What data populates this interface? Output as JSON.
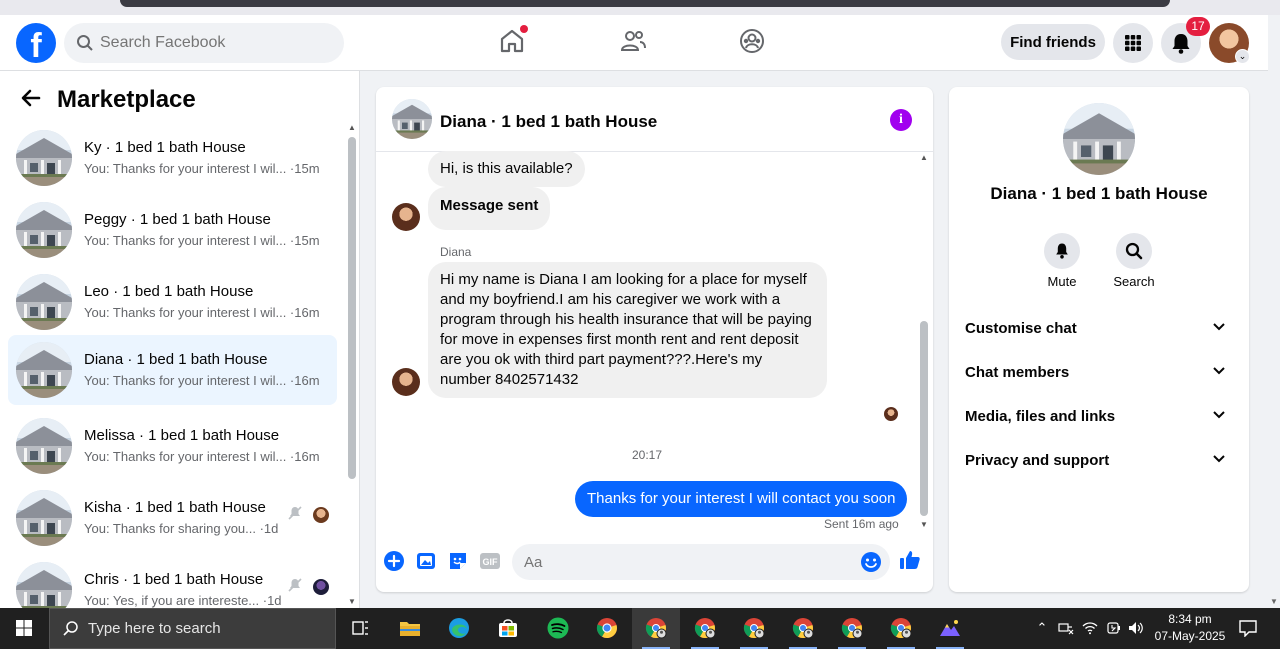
{
  "header": {
    "search_placeholder": "Search Facebook",
    "find_friends_label": "Find friends",
    "notification_count": "17",
    "logo_letter": "f"
  },
  "sidebar": {
    "title": "Marketplace",
    "conversations": [
      {
        "name": "Ky · 1 bed 1 bath House",
        "preview": "You: Thanks for your interest I wil... ·15m"
      },
      {
        "name": "Peggy · 1 bed 1 bath House",
        "preview": "You: Thanks for your interest I wil... ·15m"
      },
      {
        "name": "Leo · 1 bed 1 bath House",
        "preview": "You: Thanks for your interest I wil... ·16m"
      },
      {
        "name": "Diana · 1 bed 1 bath House",
        "preview": "You: Thanks for your interest I wil... ·16m"
      },
      {
        "name": "Melissa · 1 bed 1 bath House",
        "preview": "You: Thanks for your interest I wil... ·16m"
      },
      {
        "name": "Kisha · 1 bed 1 bath House",
        "preview": "You: Thanks for sharing you... ·1d"
      },
      {
        "name": "Chris · 1 bed 1 bath House",
        "preview": "You: Yes, if you are intereste... ·1d"
      }
    ]
  },
  "chat": {
    "title": "Diana · 1 bed 1 bath House",
    "messages": {
      "m1": "Hi, is this available?",
      "m2": "Message sent",
      "sender": "Diana",
      "m3": "Hi my name is Diana  I am looking for a place for myself and my boyfriend.I am his caregiver we work with a program through his health insurance that will be paying for move in expenses first month rent and rent deposit are you ok with third part payment???.Here's my number 8402571432",
      "time_separator": "20:17",
      "m4": "Thanks for your interest I will contact you soon",
      "sent_status": "Sent 16m ago"
    },
    "composer_placeholder": "Aa"
  },
  "details": {
    "title": "Diana · 1 bed 1 bath House",
    "actions": {
      "mute": "Mute",
      "search": "Search"
    },
    "sections": [
      "Customise chat",
      "Chat members",
      "Media, files and links",
      "Privacy and support"
    ]
  },
  "taskbar": {
    "search_placeholder": "Type here to search",
    "time": "8:34 pm",
    "date": "07-May-2025"
  },
  "colors": {
    "brand_blue": "#0866ff",
    "badge_red": "#e41e3f",
    "active_bg": "#ebf5ff",
    "info_purple": "#a100ef"
  }
}
